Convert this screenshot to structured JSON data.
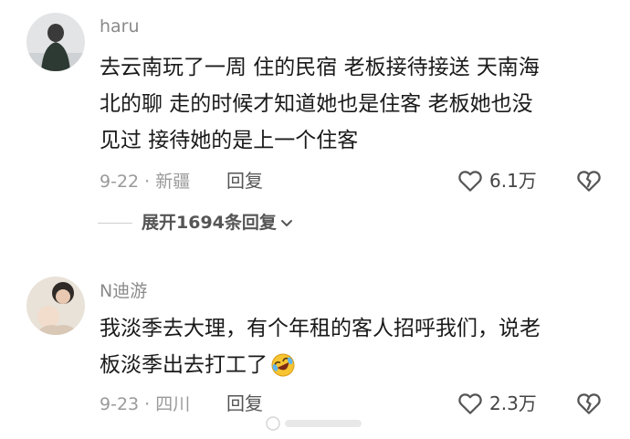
{
  "comments": [
    {
      "username": "haru",
      "lines": [
        "去云南玩了一周 住的民宿 老板接待接送 天南海",
        "北的聊 走的时候才知道她也是住客 老板她也没",
        "见过 接待她的是上一个住客"
      ],
      "date_location": "9-22 · 新疆",
      "reply_label": "回复",
      "likes": "6.1万",
      "expand_replies": "展开1694条回复"
    },
    {
      "username": "N迪游",
      "lines": [
        "我淡季去大理，有个年租的客人招呼我们，说老",
        "板淡季出去打工了"
      ],
      "date_location": "9-23 · 四川",
      "reply_label": "回复",
      "likes": "2.3万"
    }
  ],
  "icons": {
    "like": "heart-outline-icon",
    "dislike": "broken-heart-icon",
    "expand": "chevron-down-icon",
    "emoji": "rolling-laughing-emoji"
  },
  "colors": {
    "username": "#8a8a8a",
    "text": "#1a1a1a",
    "meta": "#9a9a9a",
    "icon": "#555555"
  }
}
